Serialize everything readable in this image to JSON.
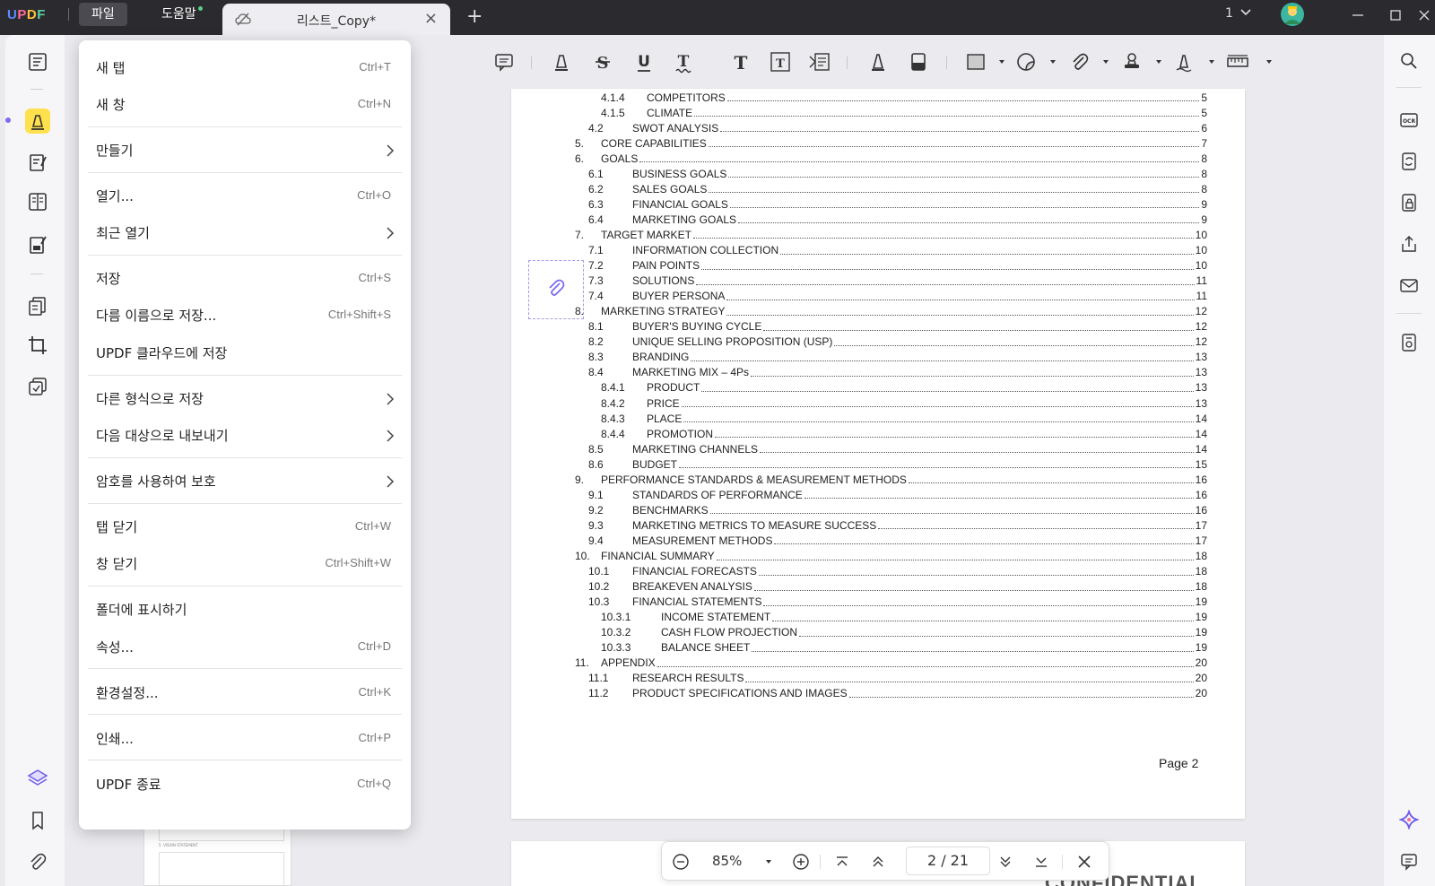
{
  "titlebar": {
    "logo": [
      "U",
      "P",
      "D",
      "F"
    ],
    "menus": [
      {
        "label": "파일"
      },
      {
        "label": "도움말"
      }
    ],
    "tab_title": "리스트_Copy*",
    "window_count": "1"
  },
  "file_menu": {
    "items": [
      {
        "label": "새 탭",
        "shortcut": "Ctrl+T"
      },
      {
        "label": "새 창",
        "shortcut": "Ctrl+N"
      },
      {
        "label": "만들기",
        "shortcut": ""
      },
      {
        "label": "열기...",
        "shortcut": "Ctrl+O"
      },
      {
        "label": "최근 열기",
        "shortcut": ""
      },
      {
        "label": "저장",
        "shortcut": "Ctrl+S"
      },
      {
        "label": "다름 이름으로 저장...",
        "shortcut": "Ctrl+Shift+S"
      },
      {
        "label": "UPDF 클라우드에 저장",
        "shortcut": ""
      },
      {
        "label": "다른 형식으로 저장",
        "shortcut": ""
      },
      {
        "label": "다음 대상으로 내보내기",
        "shortcut": ""
      },
      {
        "label": "암호를 사용하여 보호",
        "shortcut": ""
      },
      {
        "label": "탭 닫기",
        "shortcut": "Ctrl+W"
      },
      {
        "label": "창 닫기",
        "shortcut": "Ctrl+Shift+W"
      },
      {
        "label": "폴더에 표시하기",
        "shortcut": ""
      },
      {
        "label": "속성...",
        "shortcut": "Ctrl+D"
      },
      {
        "label": "환경설정...",
        "shortcut": "Ctrl+K"
      },
      {
        "label": "인쇄...",
        "shortcut": "Ctrl+P"
      },
      {
        "label": "UPDF 종료",
        "shortcut": "Ctrl+Q"
      }
    ]
  },
  "toc": [
    {
      "num": "4.1.4",
      "title": "COMPETITORS",
      "page": "5"
    },
    {
      "num": "4.1.5",
      "title": "CLIMATE",
      "page": "5"
    },
    {
      "num": "4.2",
      "title": "SWOT ANALYSIS",
      "page": "6"
    },
    {
      "num": "5.",
      "title": "CORE CAPABILITIES",
      "page": "7"
    },
    {
      "num": "6.",
      "title": "GOALS",
      "page": "8"
    },
    {
      "num": "6.1",
      "title": "BUSINESS GOALS",
      "page": "8"
    },
    {
      "num": "6.2",
      "title": "SALES GOALS",
      "page": "8"
    },
    {
      "num": "6.3",
      "title": "FINANCIAL GOALS",
      "page": "9"
    },
    {
      "num": "6.4",
      "title": "MARKETING GOALS",
      "page": "9"
    },
    {
      "num": "7.",
      "title": "TARGET MARKET",
      "page": "10"
    },
    {
      "num": "7.1",
      "title": "INFORMATION COLLECTION",
      "page": "10"
    },
    {
      "num": "7.2",
      "title": "PAIN POINTS",
      "page": "10"
    },
    {
      "num": "7.3",
      "title": "SOLUTIONS",
      "page": "11"
    },
    {
      "num": "7.4",
      "title": "BUYER PERSONA",
      "page": "11"
    },
    {
      "num": "8.",
      "title": "MARKETING STRATEGY",
      "page": "12"
    },
    {
      "num": "8.1",
      "title": "BUYER'S BUYING CYCLE",
      "page": "12"
    },
    {
      "num": "8.2",
      "title": "UNIQUE SELLING PROPOSITION (USP)",
      "page": "12"
    },
    {
      "num": "8.3",
      "title": "BRANDING",
      "page": "13"
    },
    {
      "num": "8.4",
      "title": "MARKETING MIX – 4Ps",
      "page": "13"
    },
    {
      "num": "8.4.1",
      "title": "PRODUCT",
      "page": "13"
    },
    {
      "num": "8.4.2",
      "title": "PRICE",
      "page": "13"
    },
    {
      "num": "8.4.3",
      "title": "PLACE",
      "page": "14"
    },
    {
      "num": "8.4.4",
      "title": "PROMOTION",
      "page": "14"
    },
    {
      "num": "8.5",
      "title": "MARKETING CHANNELS",
      "page": "14"
    },
    {
      "num": "8.6",
      "title": "BUDGET",
      "page": "15"
    },
    {
      "num": "9.",
      "title": "PERFORMANCE STANDARDS & MEASUREMENT METHODS",
      "page": "16"
    },
    {
      "num": "9.1",
      "title": "STANDARDS OF PERFORMANCE",
      "page": "16"
    },
    {
      "num": "9.2",
      "title": "BENCHMARKS",
      "page": "16"
    },
    {
      "num": "9.3",
      "title": "MARKETING METRICS TO MEASURE SUCCESS",
      "page": "17"
    },
    {
      "num": "9.4",
      "title": "MEASUREMENT METHODS",
      "page": "17"
    },
    {
      "num": "10.",
      "title": "FINANCIAL SUMMARY",
      "page": "18"
    },
    {
      "num": "10.1",
      "title": "FINANCIAL FORECASTS",
      "page": "18"
    },
    {
      "num": "10.2",
      "title": "BREAKEVEN ANALYSIS",
      "page": "18"
    },
    {
      "num": "10.3",
      "title": "FINANCIAL STATEMENTS",
      "page": "19"
    },
    {
      "num": "10.3.1",
      "title": "INCOME STATEMENT",
      "page": "19"
    },
    {
      "num": "10.3.2",
      "title": "CASH FLOW PROJECTION",
      "page": "19"
    },
    {
      "num": "10.3.3",
      "title": "BALANCE SHEET",
      "page": "19"
    },
    {
      "num": "11.",
      "title": "APPENDIX",
      "page": "20"
    },
    {
      "num": "11.1",
      "title": "RESEARCH RESULTS",
      "page": "20"
    },
    {
      "num": "11.2",
      "title": "PRODUCT SPECIFICATIONS AND IMAGES",
      "page": "20"
    }
  ],
  "page_footer": "Page 2",
  "next_page_header": "CONFIDENTIAL",
  "thumb_label": "5. VISION STATEMENT",
  "nav": {
    "zoom": "85%",
    "page_indicator": "2 / 21"
  },
  "colors": {
    "titlebar": "#2b2b2f",
    "accent_highlight": "#ffe04d",
    "accent_purple": "#7a6cf0",
    "attachment_border": "#a89ae8"
  }
}
